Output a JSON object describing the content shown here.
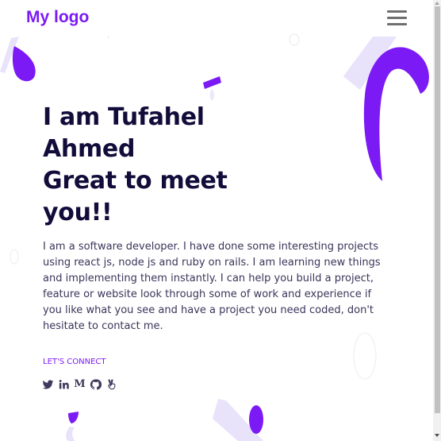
{
  "header": {
    "logo_text": "My logo",
    "menu_icon": "hamburger-menu-icon"
  },
  "hero": {
    "heading_lines": [
      "I am Tufahel",
      "Ahmed",
      "Great to meet",
      "you!!"
    ],
    "bio": "I am a software developer. I have done some interesting projects using react js, node js and ruby on rails. I am learning new things and implementing them instantly. I can help you build a project, feature or website look through some of work and experience if you like what you see and have a project you need coded, don't hesitate to contact me.",
    "connect_label": "LET'S CONNECT"
  },
  "socials": [
    {
      "icon": "twitter-icon"
    },
    {
      "icon": "linkedin-icon"
    },
    {
      "icon": "medium-icon",
      "glyph": "M"
    },
    {
      "icon": "github-icon"
    },
    {
      "icon": "angellist-icon"
    }
  ],
  "colors": {
    "accent": "#7b1af5",
    "accent_light": "#e8e2fb",
    "heading": "#120c3a",
    "text": "#3a355a"
  }
}
